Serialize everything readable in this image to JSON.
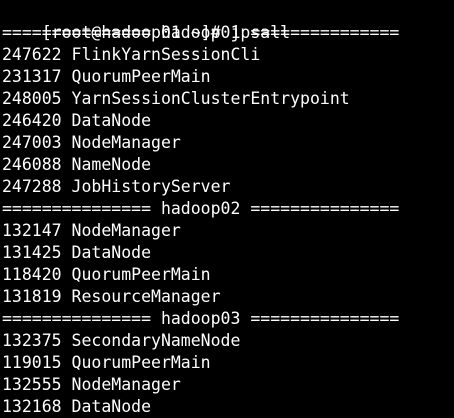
{
  "terminal": {
    "prompt": "[root@hadoop01 ~]# ",
    "command": "jpsall",
    "lines": [
      "=============== hadoop01 ===============",
      "247622 FlinkYarnSessionCli",
      "231317 QuorumPeerMain",
      "248005 YarnSessionClusterEntrypoint",
      "246420 DataNode",
      "247003 NodeManager",
      "246088 NameNode",
      "247288 JobHistoryServer",
      "=============== hadoop02 ===============",
      "132147 NodeManager",
      "131425 DataNode",
      "118420 QuorumPeerMain",
      "131819 ResourceManager",
      "=============== hadoop03 ===============",
      "132375 SecondaryNameNode",
      "119015 QuorumPeerMain",
      "132555 NodeManager",
      "132168 DataNode"
    ]
  }
}
